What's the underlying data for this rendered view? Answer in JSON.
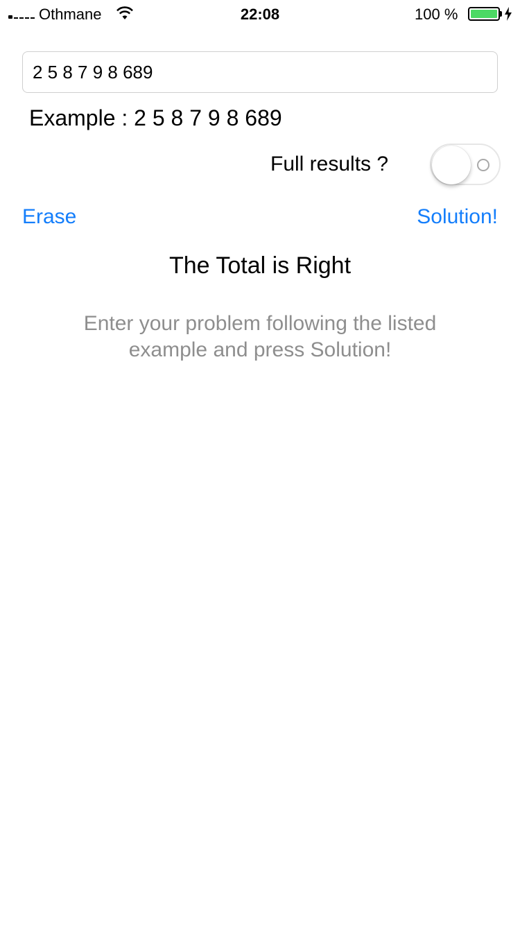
{
  "status_bar": {
    "carrier": "Othmane",
    "time": "22:08",
    "battery": "100 %",
    "colors": {
      "battery_fill": "#4cd964"
    },
    "icons": [
      "signal-icon",
      "wifi-icon",
      "battery-icon",
      "charging-bolt-icon"
    ]
  },
  "input": {
    "value": "2 5 8 7 9 8 689",
    "placeholder": ""
  },
  "example": {
    "text": "Example : 2 5 8 7 9 8 689"
  },
  "full_results": {
    "label": "Full results ?",
    "enabled": false
  },
  "actions": {
    "erase_label": "Erase",
    "solution_label": "Solution!",
    "accent_color": "#147efb"
  },
  "result": {
    "title": "The Total is Right",
    "instructions": "Enter your problem following the listed example and press Solution!"
  }
}
